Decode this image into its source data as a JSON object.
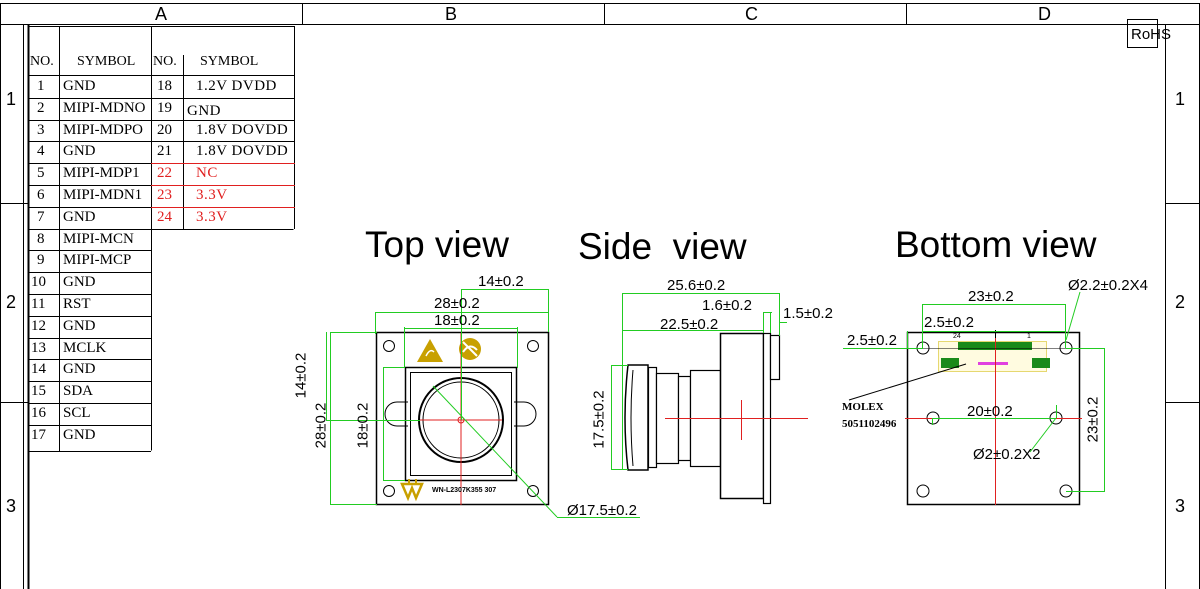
{
  "frame": {
    "col_labels": [
      "A",
      "B",
      "C",
      "D"
    ],
    "row_labels": [
      "1",
      "2",
      "3"
    ],
    "rohs": "RoHS"
  },
  "pin_table": {
    "left_header": {
      "no": "NO.",
      "symbol": "SYMBOL"
    },
    "right_header": {
      "no": "NO.",
      "symbol": "SYMBOL"
    },
    "left": [
      {
        "no": "1",
        "symbol": "GND"
      },
      {
        "no": "2",
        "symbol": "MIPI-MDNO"
      },
      {
        "no": "3",
        "symbol": "MIPI-MDPO"
      },
      {
        "no": "4",
        "symbol": "GND"
      },
      {
        "no": "5",
        "symbol": "MIPI-MDP1"
      },
      {
        "no": "6",
        "symbol": "MIPI-MDN1"
      },
      {
        "no": "7",
        "symbol": "GND"
      },
      {
        "no": "8",
        "symbol": "MIPI-MCN"
      },
      {
        "no": "9",
        "symbol": "MIPI-MCP"
      },
      {
        "no": "10",
        "symbol": "GND"
      },
      {
        "no": "11",
        "symbol": "RST"
      },
      {
        "no": "12",
        "symbol": "GND"
      },
      {
        "no": "13",
        "symbol": "MCLK"
      },
      {
        "no": "14",
        "symbol": "GND"
      },
      {
        "no": "15",
        "symbol": "SDA"
      },
      {
        "no": "16",
        "symbol": "SCL"
      },
      {
        "no": "17",
        "symbol": "GND"
      }
    ],
    "right": [
      {
        "no": "18",
        "symbol": "1.2V DVDD",
        "highlight": false
      },
      {
        "no": "19",
        "symbol": "GND",
        "highlight": false
      },
      {
        "no": "20",
        "symbol": "1.8V DOVDD",
        "highlight": false
      },
      {
        "no": "21",
        "symbol": "1.8V DOVDD",
        "highlight": false
      },
      {
        "no": "22",
        "symbol": "NC",
        "highlight": true
      },
      {
        "no": "23",
        "symbol": "3.3V",
        "highlight": true
      },
      {
        "no": "24",
        "symbol": "3.3V",
        "highlight": true
      }
    ],
    "highlight_color": "#e02020"
  },
  "views": {
    "top_title": "Top view",
    "side_title": "Side  view",
    "bottom_title": "Bottom view"
  },
  "top_view": {
    "dims": {
      "d14_top": "14±0.2",
      "d28_top": "28±0.2",
      "d18_top": "18±0.2",
      "d14_left": "14±0.2",
      "d28_left": "28±0.2",
      "d18_left": "18±0.2",
      "lens_dia": "Ø17.5±0.2"
    },
    "marking": "WN-L2307K355 307"
  },
  "side_view": {
    "dims": {
      "d25_6": "25.6±0.2",
      "d1_6": "1.6±0.2",
      "d22_5": "22.5±0.2",
      "d1_5": "1.5±0.2",
      "d17_5": "17.5±0.2"
    }
  },
  "bottom_view": {
    "dims": {
      "d23_top": "23±0.2",
      "hole_big": "Ø2.2±0.2X4",
      "d2_5_h": "2.5±0.2",
      "d2_5_v": "2.5±0.2",
      "d20": "20±0.2",
      "d23_right": "23±0.2",
      "hole_small": "Ø2±0.2X2"
    },
    "connector_pin_24": "24",
    "connector_pin_1": "1",
    "connector_brand": "MOLEX",
    "connector_part": "5051102496"
  },
  "colors": {
    "dimension": "#22cc22",
    "centerline": "#e02020",
    "outline": "#000000",
    "logo_gold": "#c8a000",
    "connector_green": "#1a8a1a",
    "connector_pink": "#e040e0"
  }
}
